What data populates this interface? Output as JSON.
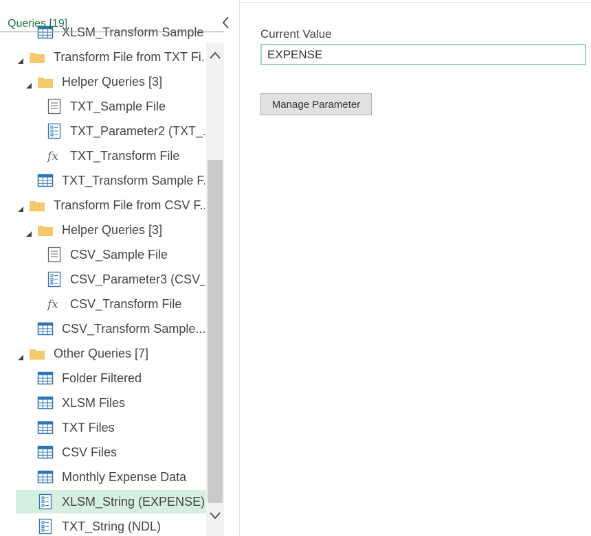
{
  "queries_pane": {
    "header": "Queries [19]",
    "items": [
      {
        "label": "XLSM_Transform Sample...",
        "type": "table",
        "level": 1
      },
      {
        "label": "Transform File from TXT Fi...",
        "type": "folder",
        "level": 0
      },
      {
        "label": "Helper Queries [3]",
        "type": "folder",
        "level": 1
      },
      {
        "label": "TXT_Sample File",
        "type": "list",
        "level": 2
      },
      {
        "label": "TXT_Parameter2 (TXT_...",
        "type": "param",
        "level": 2
      },
      {
        "label": "TXT_Transform File",
        "type": "fx",
        "level": 2
      },
      {
        "label": "TXT_Transform Sample F...",
        "type": "table",
        "level": 1
      },
      {
        "label": "Transform File from CSV F...",
        "type": "folder",
        "level": 0
      },
      {
        "label": "Helper Queries [3]",
        "type": "folder",
        "level": 1
      },
      {
        "label": "CSV_Sample File",
        "type": "list",
        "level": 2
      },
      {
        "label": "CSV_Parameter3 (CSV_...",
        "type": "param",
        "level": 2
      },
      {
        "label": "CSV_Transform File",
        "type": "fx",
        "level": 2
      },
      {
        "label": "CSV_Transform Sample...",
        "type": "table",
        "level": 1
      },
      {
        "label": "Other Queries [7]",
        "type": "folder",
        "level": 0
      },
      {
        "label": "Folder Filtered",
        "type": "table",
        "level": 1
      },
      {
        "label": "XLSM Files",
        "type": "table",
        "level": 1
      },
      {
        "label": "TXT Files",
        "type": "table",
        "level": 1
      },
      {
        "label": "CSV Files",
        "type": "table",
        "level": 1
      },
      {
        "label": "Monthly Expense Data",
        "type": "table",
        "level": 1
      },
      {
        "label": "XLSM_String (EXPENSE)",
        "type": "param",
        "level": 1
      },
      {
        "label": "TXT_String (NDL)",
        "type": "param",
        "level": 1
      }
    ],
    "selected_item": "XLSM_String (EXPENSE)"
  },
  "parameter": {
    "field_label": "Current Value",
    "current_value": "EXPENSE",
    "manage_button": "Manage Parameter"
  },
  "colors": {
    "accent_green": "#217346",
    "selection": "#d5efe1",
    "input_border": "#9fd4b6",
    "folder": "#f4c96a",
    "table_icon": "#2e75b6"
  }
}
